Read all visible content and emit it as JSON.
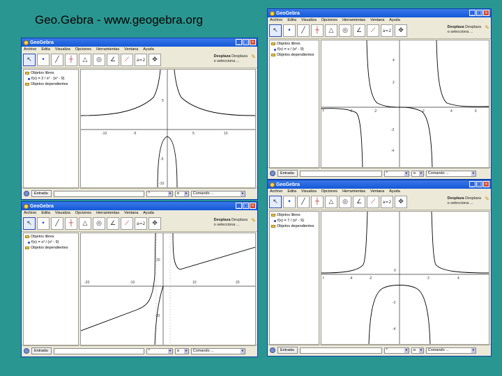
{
  "slide": {
    "title": "Geo.Gebra - www.geogebra.org"
  },
  "app": {
    "title": "GeoGebra"
  },
  "menu": [
    "Archivo",
    "Edita",
    "Visualiza",
    "Opciones",
    "Herramientas",
    "Ventana",
    "Ayuda"
  ],
  "tools": [
    "pointer",
    "point",
    "line",
    "perpendicular",
    "polygon",
    "circle",
    "angle",
    "reflect",
    "slider",
    "move-view"
  ],
  "tool_help": {
    "name": "Desplaza",
    "desc_a": "Desplaza",
    "desc_b": "o selecciona ..."
  },
  "algebra": {
    "free_objects": "Objetos libres",
    "dependent_objects": "Objetos dependientes"
  },
  "input": {
    "entry_label": "Entrada:",
    "symbol_select": "*",
    "greek_select": "α",
    "command_placeholder": "Comando ..."
  },
  "windows": [
    {
      "id": "tl",
      "formula": "f(x) = 2 / x² · (x² - 9)"
    },
    {
      "id": "tr",
      "formula": "f(x) = x / (x² - 9)"
    },
    {
      "id": "bl",
      "formula": "f(x) = x³ / (x² - 9)"
    },
    {
      "id": "br",
      "formula": "f(x) = 7 / (x² - 9)"
    }
  ],
  "colors": {
    "background": "#2a9691",
    "titlebar": "#1458d8",
    "window": "#ece9d8"
  }
}
